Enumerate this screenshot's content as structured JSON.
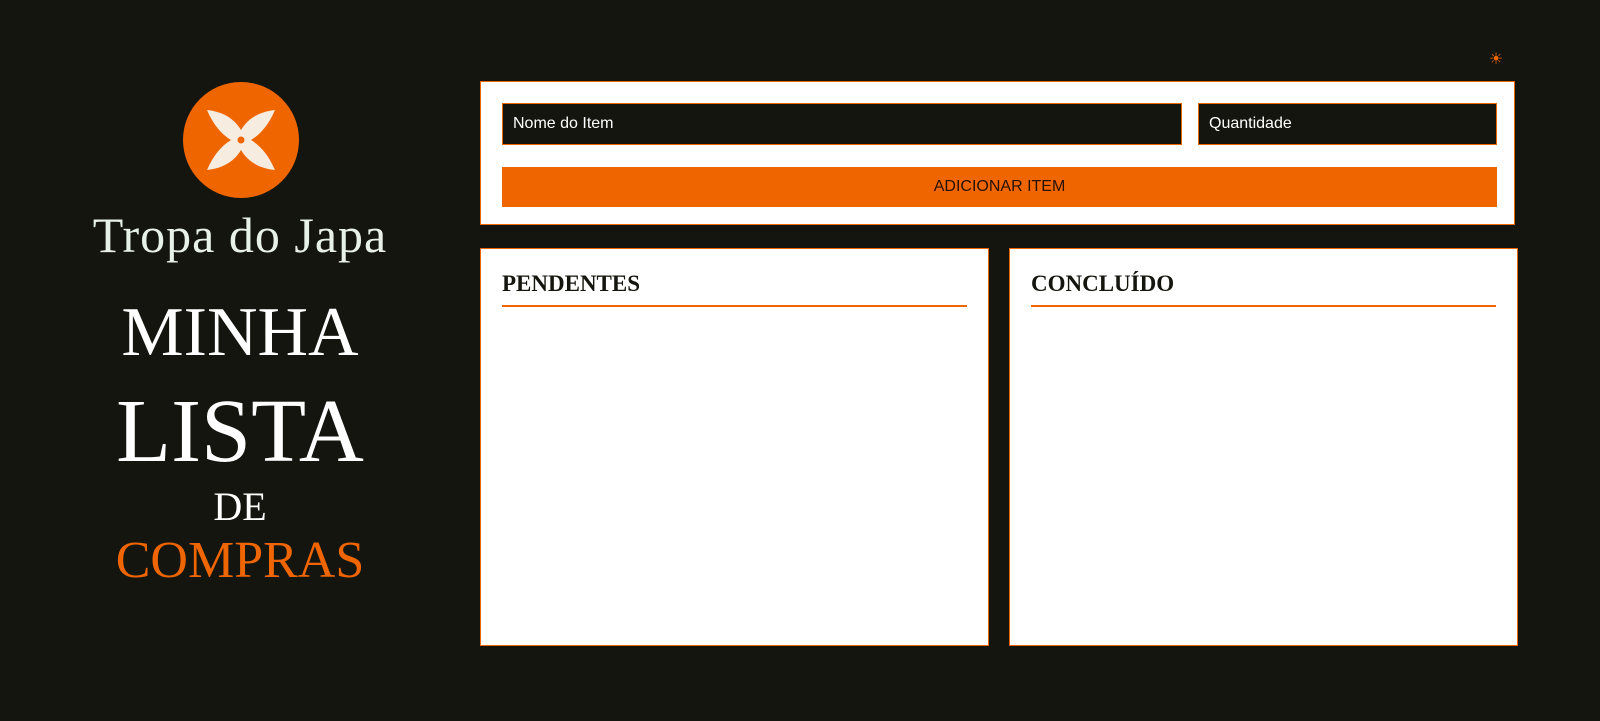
{
  "brand": {
    "name": "Tropa do Japa",
    "logo_icon": "shuriken-icon",
    "accent_color": "#ef6500"
  },
  "title": {
    "line1": "MINHA",
    "line2": "LISTA",
    "line3": "DE",
    "line4": "COMPRAS"
  },
  "theme_toggle": {
    "icon": "sun-icon",
    "glyph": "☀"
  },
  "form": {
    "name_placeholder": "Nome do Item",
    "quantity_placeholder": "Quantidade",
    "add_button_label": "ADICIONAR ITEM"
  },
  "lists": {
    "pending": {
      "heading": "PENDENTES",
      "items": []
    },
    "done": {
      "heading": "CONCLUÍDO",
      "items": []
    }
  }
}
